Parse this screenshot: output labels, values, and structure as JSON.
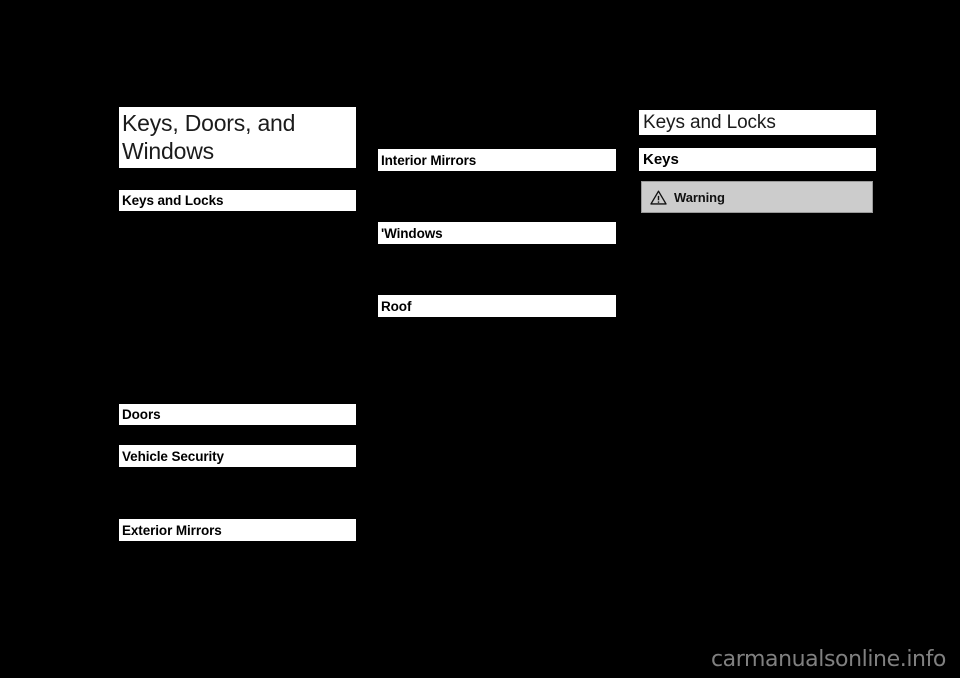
{
  "document": {
    "chapter_title": "Keys, Doors, and Windows",
    "background_color": "#000000",
    "band_color": "#ffffff",
    "warning_fill_color": "#cccccc",
    "warning_border_color": "#9a9a9a",
    "watermark_color": "#808080"
  },
  "columns": {
    "left": {
      "entries": [
        {
          "label": "Keys and Locks"
        },
        {
          "label": "Doors"
        },
        {
          "label": "Vehicle Security"
        },
        {
          "label": "Exterior Mirrors"
        }
      ]
    },
    "middle": {
      "entries": [
        {
          "label": "Interior Mirrors"
        },
        {
          "label": "'Windows"
        },
        {
          "label": "Roof"
        }
      ]
    },
    "right": {
      "section_title": "Keys and Locks",
      "subsection_title": "Keys",
      "warning": {
        "icon": "warning-triangle-icon",
        "label": "Warning"
      }
    }
  },
  "footer": {
    "watermark": "carmanualsonline.info"
  }
}
